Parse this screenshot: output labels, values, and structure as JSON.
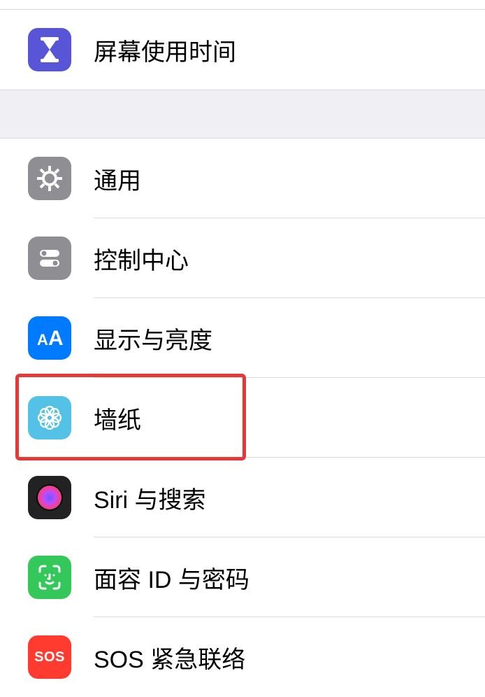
{
  "group1": {
    "screen_time": {
      "label": "屏幕使用时间"
    }
  },
  "group2": {
    "general": {
      "label": "通用"
    },
    "control_center": {
      "label": "控制中心"
    },
    "display": {
      "label": "显示与亮度"
    },
    "wallpaper": {
      "label": "墙纸"
    },
    "siri": {
      "label": "Siri 与搜索"
    },
    "faceid": {
      "label": "面容 ID 与密码"
    },
    "sos": {
      "label": "SOS 紧急联络",
      "icon_text": "SOS"
    }
  },
  "highlight": {
    "target": "wallpaper"
  }
}
